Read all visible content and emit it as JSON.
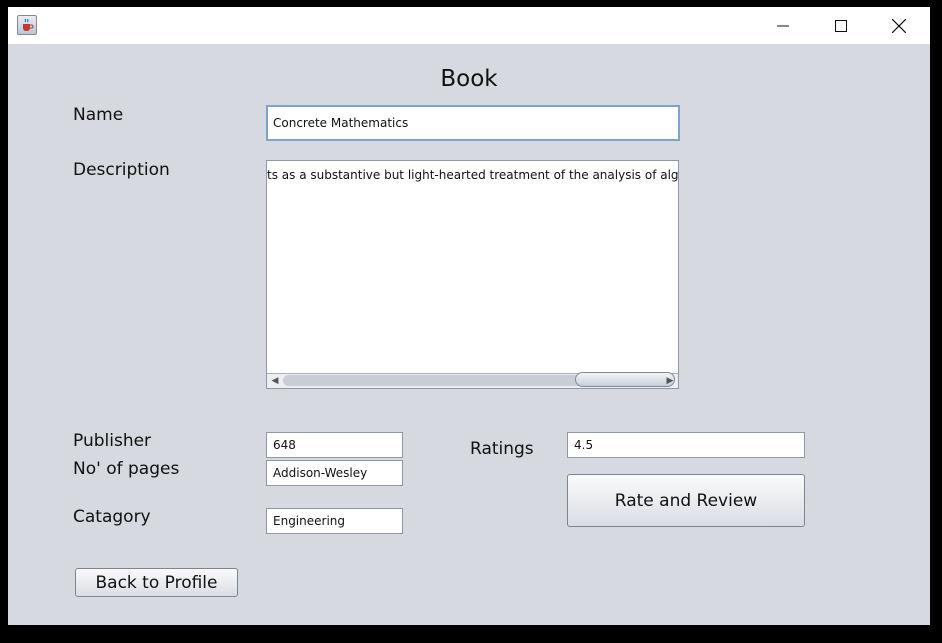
{
  "window": {
    "title": ""
  },
  "form": {
    "heading": "Book",
    "name_label": "Name",
    "name_value": "Concrete Mathematics",
    "description_label": "Description",
    "description_value": "ts as a substantive but light-hearted treatment of the analysis of algorithms.",
    "publisher_label": "Publisher",
    "publisher_value": "648",
    "pages_label": "No' of pages",
    "pages_value": "Addison-Wesley",
    "category_label": "Catagory",
    "category_value": "Engineering",
    "ratings_label": "Ratings",
    "ratings_value": "4.5"
  },
  "buttons": {
    "rate_review": "Rate and Review",
    "back_profile": "Back to Profile"
  },
  "icons": {
    "app": "java-cup-icon",
    "minimize": "minimize-icon",
    "maximize": "maximize-icon",
    "close": "close-icon"
  }
}
